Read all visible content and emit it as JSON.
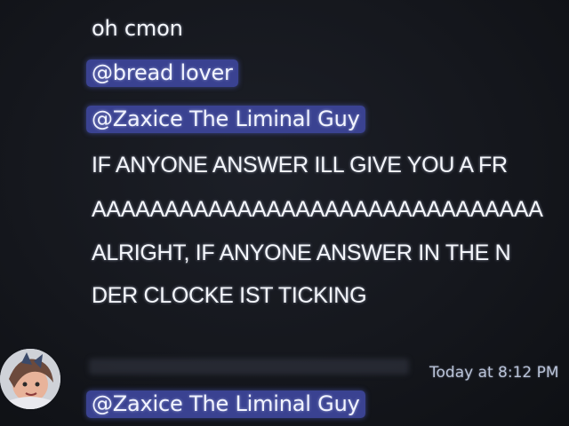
{
  "messages": [
    {
      "text": "oh cmon",
      "kind": "plain"
    },
    {
      "text": "@bread lover",
      "kind": "mention"
    },
    {
      "text": "@Zaxice The Liminal Guy",
      "kind": "mention"
    },
    {
      "text": "IF ANYONE ANSWER ILL GIVE YOU A FR",
      "kind": "caps"
    },
    {
      "text": "AAAAAAAAAAAAAAAAAAAAAAAAAAAAAAA",
      "kind": "caps"
    },
    {
      "text": "ALRIGHT, IF ANYONE ANSWER IN THE N",
      "kind": "caps"
    },
    {
      "text": "DER CLOCKE IST TICKING",
      "kind": "caps"
    }
  ],
  "next_message": {
    "timestamp": "Today at 8:12 PM",
    "mention": "@Zaxice The Liminal Guy",
    "avatar_icon": "cartoon-avatar-icon"
  },
  "colors": {
    "background": "#14161b",
    "mention_bg": "#3a4291",
    "text": "#f4f6fb",
    "timestamp": "#b9c3d8"
  }
}
